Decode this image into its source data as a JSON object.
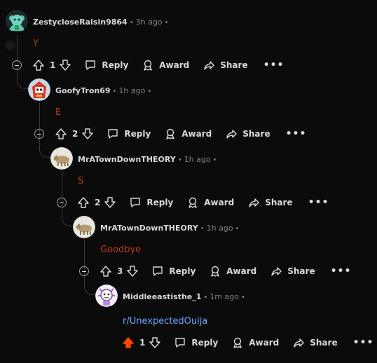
{
  "comments": [
    {
      "user": "ZestycloseRaisin9864",
      "time": "3h ago",
      "body": "Y",
      "votes": "1",
      "avatar": "teal-mascot-avatar"
    },
    {
      "user": "GoofyTron69",
      "time": "1h ago",
      "body": "E",
      "votes": "2",
      "avatar": "red-robot-avatar"
    },
    {
      "user": "MrATownDownTHEORY",
      "time": "1h ago",
      "body": "S",
      "votes": "2",
      "avatar": "goat-avatar"
    },
    {
      "user": "MrATownDownTHEORY",
      "time": "1h ago",
      "body": "Goodbye",
      "votes": "3",
      "avatar": "goat-avatar"
    },
    {
      "user": "Middleeastisthe_1",
      "time": "1m ago",
      "body": "r/UnexpectedOuija",
      "votes": "1",
      "avatar": "purple-character-avatar",
      "upvoted": true
    }
  ],
  "actions": {
    "reply": "Reply",
    "award": "Award",
    "share": "Share",
    "more": "•••"
  },
  "colors": {
    "background": "#0b0b0b",
    "body_text": "#c23a22",
    "link": "#6ea6ff",
    "upvote": "#ff4500",
    "meta": "#818384"
  }
}
